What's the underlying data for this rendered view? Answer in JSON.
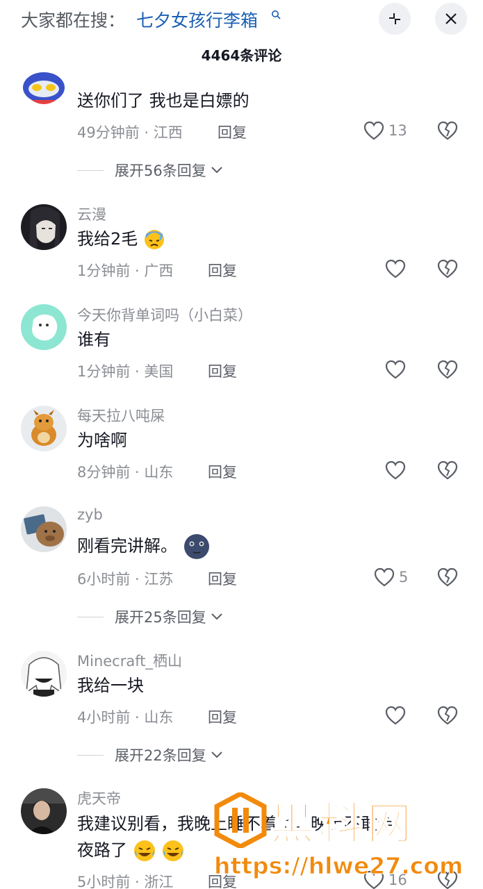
{
  "header": {
    "search_prefix": "大家都在搜：",
    "search_query": "七夕女孩行李箱",
    "search_icon": "search-icon",
    "collapse_icon": "collapse-icon",
    "close_icon": "close-icon",
    "comment_count": "4464条评论"
  },
  "comments": [
    {
      "name": "",
      "text": "送你们了 我也是白嫖的",
      "time": "49分钟前",
      "location": "江西",
      "reply": "回复",
      "likes": "13",
      "expand": "展开56条回复"
    },
    {
      "name": "云漫",
      "text": "我给2毛",
      "time": "1分钟前",
      "location": "广西",
      "reply": "回复",
      "likes": ""
    },
    {
      "name": "今天你背单词吗（小白菜）",
      "text": "谁有",
      "time": "1分钟前",
      "location": "美国",
      "reply": "回复",
      "likes": ""
    },
    {
      "name": "每天拉八吨屎",
      "text": "为啥啊",
      "time": "8分钟前",
      "location": "山东",
      "reply": "回复",
      "likes": ""
    },
    {
      "name": "zyb",
      "text": "刚看完讲解。",
      "time": "6小时前",
      "location": "江苏",
      "reply": "回复",
      "likes": "5",
      "expand": "展开25条回复"
    },
    {
      "name": "Minecraft_栖山",
      "text": "我给一块",
      "time": "4小时前",
      "location": "山东",
      "reply": "回复",
      "likes": "",
      "expand": "展开22条回复"
    },
    {
      "name": "虎天帝",
      "text": "我建议别看，我晚上睡不着了，晚上不敢走",
      "text2": "夜路了",
      "time": "5小时前",
      "location": "浙江",
      "reply": "回复",
      "likes": "16"
    }
  ],
  "watermark": {
    "title": "黑料网",
    "url": "https://hlwe27.com"
  },
  "colors": {
    "link_blue": "#1a5fb4",
    "meta_gray": "#8a8d93",
    "watermark_orange": "#f28a0c"
  }
}
